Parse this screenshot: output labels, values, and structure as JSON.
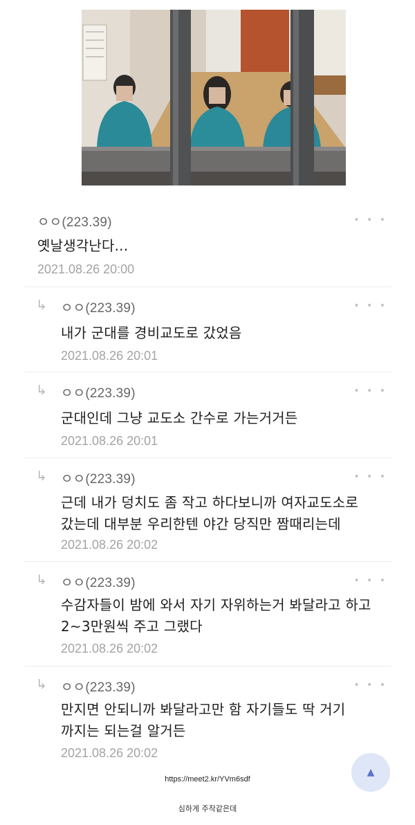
{
  "comments": [
    {
      "author": "ㅇㅇ(223.39)",
      "text": "옛날생각난다...",
      "time": "2021.08.26 20:00",
      "reply": false
    },
    {
      "author": "ㅇㅇ(223.39)",
      "text": "내가 군대를 경비교도로 갔었음",
      "time": "2021.08.26 20:01",
      "reply": true
    },
    {
      "author": "ㅇㅇ(223.39)",
      "text": "군대인데 그냥 교도소 간수로 가는거거든",
      "time": "2021.08.26 20:01",
      "reply": true
    },
    {
      "author": "ㅇㅇ(223.39)",
      "text": "근데 내가 덩치도 좀 작고 하다보니까 여자교도소로\n갔는데 대부분 우리한텐 야간 당직만 짬때리는데",
      "time": "2021.08.26 20:02",
      "reply": true
    },
    {
      "author": "ㅇㅇ(223.39)",
      "text": "수감자들이 밤에 와서 자기 자위하는거 봐달라고 하고\n2~3만원씩 주고 그랬다",
      "time": "2021.08.26 20:02",
      "reply": true
    },
    {
      "author": "ㅇㅇ(223.39)",
      "text": "만지면 안되니까 봐달라고만 함 자기들도 딱 거기\n까지는 되는걸 알거든",
      "time": "2021.08.26 20:02",
      "reply": true
    }
  ],
  "icons": {
    "reply": "reply-arrow-icon",
    "more": "more-dots-icon"
  },
  "reply_glyph": "↳",
  "more_glyph": "• • •",
  "fab_glyph": "▲",
  "url": "https://meet2.kr/YVm6sdf",
  "caption": "심하게 주작같은데"
}
